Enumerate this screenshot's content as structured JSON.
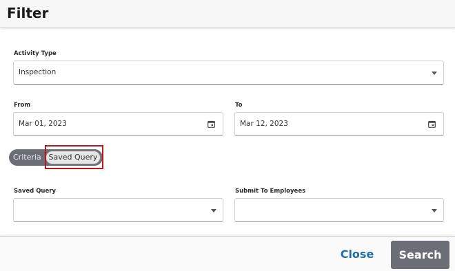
{
  "dialog": {
    "title": "Filter"
  },
  "activity_type": {
    "label": "Activity Type",
    "value": "Inspection"
  },
  "from": {
    "label": "From",
    "value": "Mar 01, 2023"
  },
  "to": {
    "label": "To",
    "value": "Mar 12, 2023"
  },
  "mode_toggle": {
    "options": [
      "Criteria",
      "Saved Query"
    ],
    "selected": "Saved Query"
  },
  "saved_query": {
    "label": "Saved Query",
    "value": ""
  },
  "submit_to_employees": {
    "label": "Submit To Employees",
    "value": ""
  },
  "footer": {
    "close_label": "Close",
    "search_label": "Search"
  },
  "colors": {
    "accent_link": "#1f6fa8",
    "button_gray": "#6b6d77",
    "highlight": "#c0141b"
  }
}
